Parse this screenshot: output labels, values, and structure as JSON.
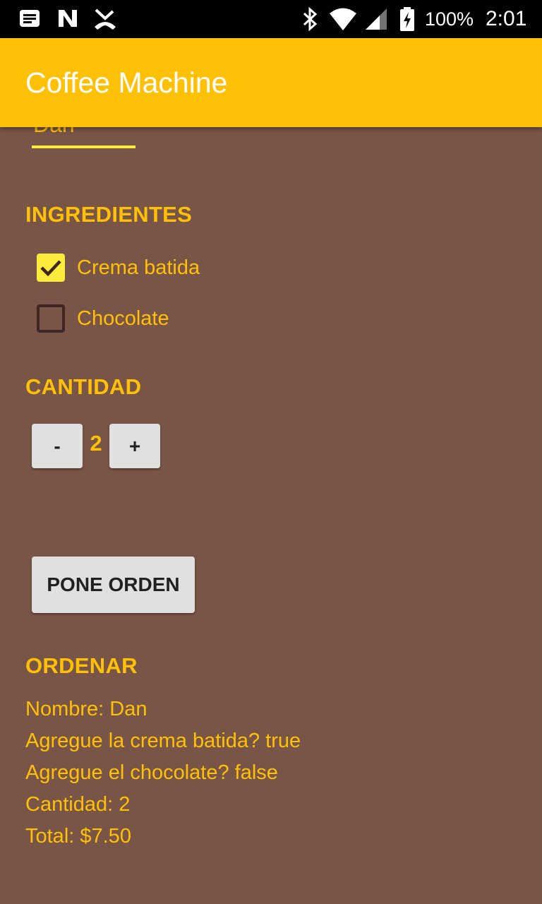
{
  "status_bar": {
    "battery_percent": "100%",
    "time": "2:01"
  },
  "app_bar": {
    "title": "Coffee Machine",
    "color": "#FFC107"
  },
  "name_input": {
    "value": "Dan"
  },
  "ingredients": {
    "title": "INGREDIENTES",
    "items": [
      {
        "label": "Crema batida",
        "checked": true
      },
      {
        "label": "Chocolate",
        "checked": false
      }
    ]
  },
  "quantity": {
    "title": "CANTIDAD",
    "decrement_label": "-",
    "value": "2",
    "increment_label": "+"
  },
  "order_button": {
    "label": "PONE ORDEN"
  },
  "summary": {
    "title": "ORDENAR",
    "lines": [
      "Nombre: Dan",
      "Agregue la crema batida? true",
      "Agregue el chocolate? false",
      "Cantidad: 2",
      "Total: $7.50"
    ]
  },
  "colors": {
    "background": "#795548",
    "accent": "#FFC107",
    "checkbox_checked": "#FFEB3B"
  }
}
